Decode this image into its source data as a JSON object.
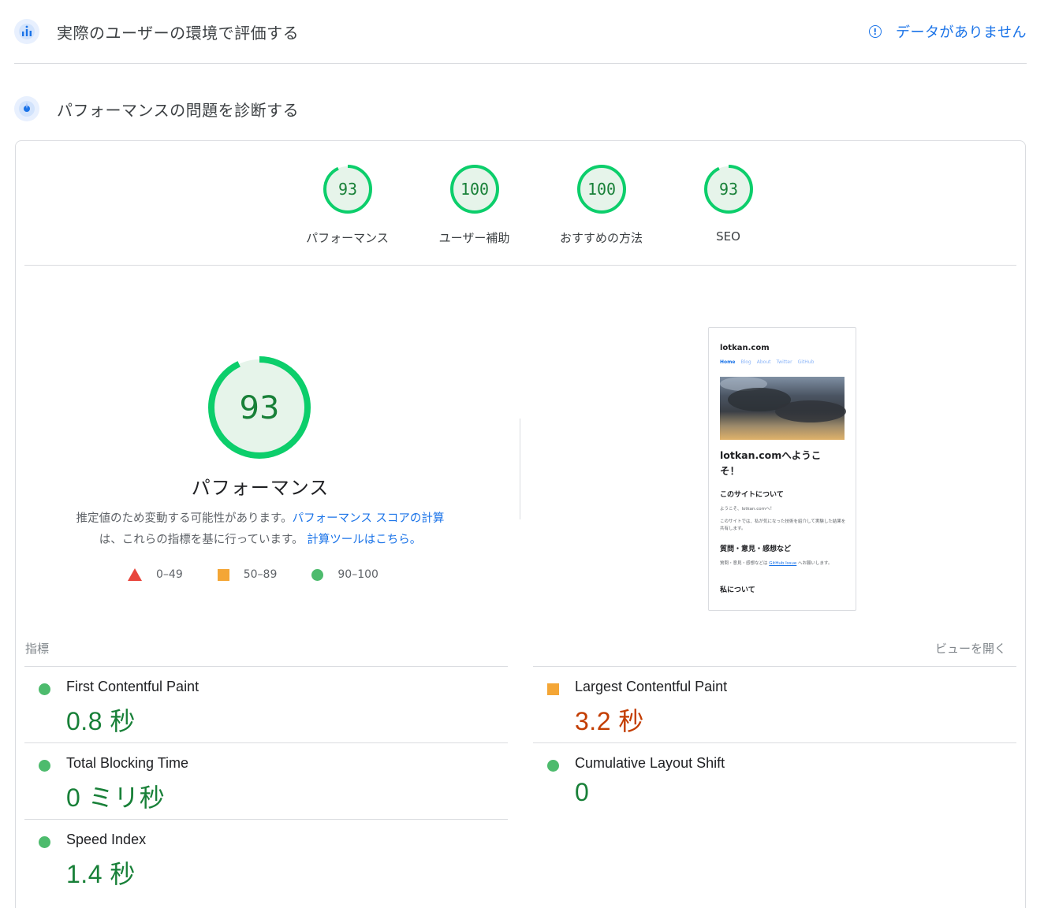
{
  "field_section": {
    "title": "実際のユーザーの環境で評価する",
    "no_data": "データがありません",
    "icon": "crux-people-icon"
  },
  "lab_section": {
    "title": "パフォーマンスの問題を診断する",
    "icon": "lighthouse-icon"
  },
  "category_gauges": [
    {
      "label": "パフォーマンス",
      "score": 93
    },
    {
      "label": "ユーザー補助",
      "score": 100
    },
    {
      "label": "おすすめの方法",
      "score": 100
    },
    {
      "label": "SEO",
      "score": 93
    }
  ],
  "performance": {
    "score": 93,
    "title": "パフォーマンス",
    "desc_1": "推定値のため変動する可能性があります。",
    "desc_link_1": "パフォーマンス スコアの計算",
    "desc_2": "は、これらの指標を基に行っています。",
    "desc_link_2": "計算ツールはこちら。"
  },
  "legend": [
    {
      "range": "0–49",
      "shape": "triangle",
      "color": "#e8453c"
    },
    {
      "range": "50–89",
      "shape": "square",
      "color": "#f4a636"
    },
    {
      "range": "90–100",
      "shape": "circle",
      "color": "#4dbb6d"
    }
  ],
  "screenshot": {
    "site": "lotkan.com",
    "nav": [
      "Home",
      "Blog",
      "About",
      "Twitter",
      "GitHub"
    ],
    "heading": "lotkan.comへようこそ！",
    "about_heading": "このサイトについて",
    "about_line": "ようこそ、lotkan.comへ！",
    "about_text": "このサイトでは、私が気になった技術を紹介して実験した結果を共有します。",
    "question_heading": "質問・意見・感想など",
    "question_text": "質問・意見・感想などは",
    "question_link": "GitHub Issue",
    "question_text2": "へお願いします。",
    "me_heading": "私について"
  },
  "metrics": {
    "label": "指標",
    "expand": "ビューを開く",
    "left": [
      {
        "name": "First Contentful Paint",
        "value": "0.8 秒",
        "rating": "good"
      },
      {
        "name": "Total Blocking Time",
        "value": "0 ミリ秒",
        "rating": "good"
      },
      {
        "name": "Speed Index",
        "value": "1.4 秒",
        "rating": "good"
      }
    ],
    "right": [
      {
        "name": "Largest Contentful Paint",
        "value": "3.2 秒",
        "rating": "average"
      },
      {
        "name": "Cumulative Layout Shift",
        "value": "0",
        "rating": "good"
      }
    ]
  },
  "colors": {
    "good_ring": "#0cce6b",
    "good_fill": "#e6f4ea",
    "good_text": "#188038",
    "average_text": "#c33d01",
    "link": "#1a73e8"
  }
}
